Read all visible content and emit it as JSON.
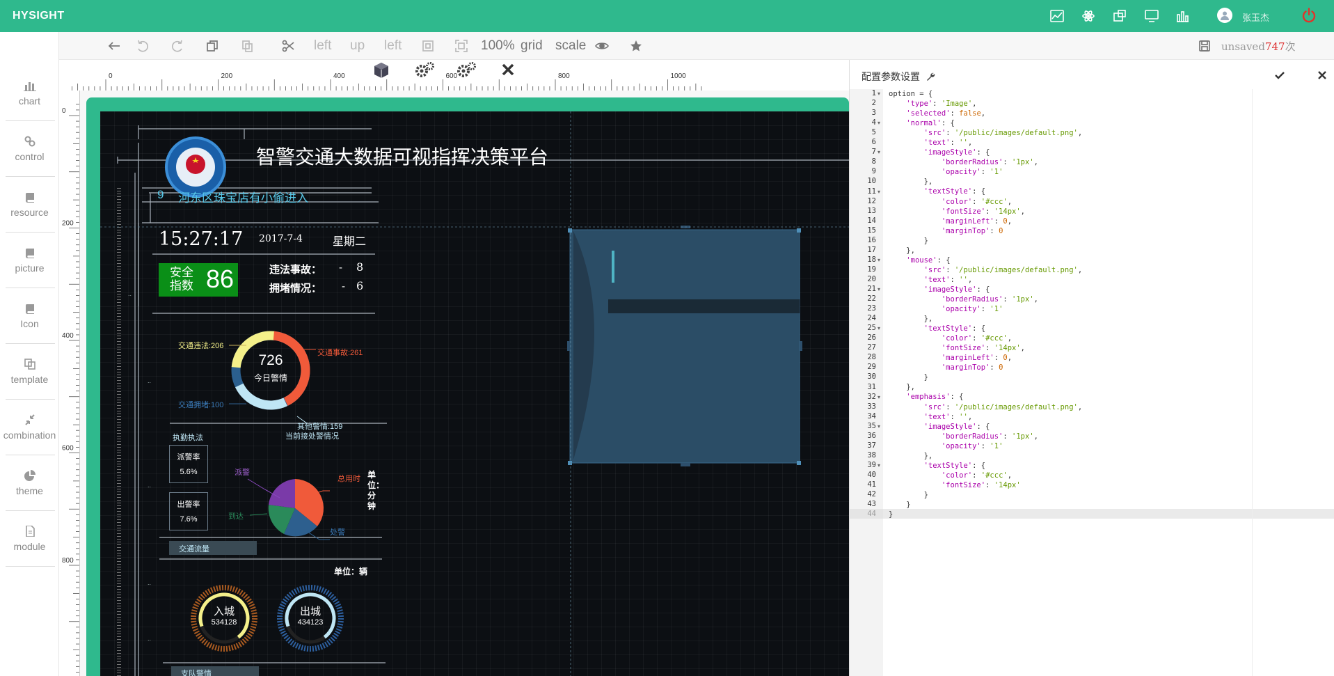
{
  "app": {
    "brand": "HYSIGHT",
    "username": "张玉杰"
  },
  "topbar_icons": [
    "image-chart-icon",
    "atom-icon",
    "puzzle-icon",
    "monitor-icon",
    "bar-chart-icon"
  ],
  "sidebar": {
    "items": [
      {
        "label": "chart",
        "icon": "chart-icon"
      },
      {
        "label": "control",
        "icon": "link-icon"
      },
      {
        "label": "resource",
        "icon": "book-icon"
      },
      {
        "label": "picture",
        "icon": "book-icon"
      },
      {
        "label": "Icon",
        "icon": "book-icon"
      },
      {
        "label": "template",
        "icon": "copy-icon"
      },
      {
        "label": "combination",
        "icon": "compress-icon"
      },
      {
        "label": "theme",
        "icon": "pie-icon"
      },
      {
        "label": "module",
        "icon": "file-icon"
      }
    ]
  },
  "toolbar": {
    "left1": "left",
    "up": "up",
    "left2": "left",
    "zoom": "100%",
    "grid": "grid",
    "scale": "scale",
    "save_prefix": "unsaved",
    "save_count": "747",
    "save_suffix": "次"
  },
  "rulers": {
    "h": [
      "0",
      "200",
      "400",
      "600",
      "800",
      "1000"
    ],
    "v": [
      "0",
      "200",
      "400",
      "600",
      "800"
    ]
  },
  "dashboard": {
    "title": "智警交通大数据可视指挥决策平台",
    "alert_num": "9",
    "alert_text": "河东区珠宝店有小偷进入",
    "time": "15:27:17",
    "date": "2017-7-4",
    "weekday": "星期二",
    "safety_label1": "安全",
    "safety_label2": "指数",
    "safety_value": "86",
    "violation_label": "违法事故：",
    "violation_dash": "-",
    "violation_value": "8",
    "jam_label": "拥堵情况：",
    "jam_dash": "-",
    "jam_value": "6",
    "donut_total": "726",
    "donut_caption": "今日警情",
    "donut_labels": {
      "a": "交通违法:206",
      "b": "交通事故:261",
      "c": "交通拥堵:100",
      "d": "其他警情:159"
    },
    "enforce_title": "执勤执法",
    "handling_title": "当前接处警情况",
    "dispatch_label": "派警率",
    "dispatch_value": "5.6%",
    "outgoing_label": "出警率",
    "outgoing_value": "7.6%",
    "pie_labels": {
      "a": "派警",
      "b": "总用时",
      "c": "到达",
      "d": "处警"
    },
    "unit_vertical": "单位：分钟",
    "flow_title": "交通流量",
    "unit_vehicle": "单位：辆",
    "in_label": "入城",
    "in_value": "534128",
    "out_label": "出城",
    "out_value": "434123",
    "bottom_title": "支队警情"
  },
  "panel": {
    "title": "配置参数设置"
  },
  "code_lines": [
    [
      [
        "p",
        "option = {"
      ]
    ],
    [
      [
        "p",
        "    "
      ],
      [
        "k",
        "'type'"
      ],
      [
        "p",
        ": "
      ],
      [
        "s",
        "'Image'"
      ],
      [
        "p",
        ","
      ]
    ],
    [
      [
        "p",
        "    "
      ],
      [
        "k",
        "'selected'"
      ],
      [
        "p",
        ": "
      ],
      [
        "b",
        "false"
      ],
      [
        "p",
        ","
      ]
    ],
    [
      [
        "p",
        "    "
      ],
      [
        "k",
        "'normal'"
      ],
      [
        "p",
        ": {"
      ]
    ],
    [
      [
        "p",
        "        "
      ],
      [
        "k",
        "'src'"
      ],
      [
        "p",
        ": "
      ],
      [
        "s",
        "'/public/images/default.png'"
      ],
      [
        "p",
        ","
      ]
    ],
    [
      [
        "p",
        "        "
      ],
      [
        "k",
        "'text'"
      ],
      [
        "p",
        ": "
      ],
      [
        "s",
        "''"
      ],
      [
        "p",
        ","
      ]
    ],
    [
      [
        "p",
        "        "
      ],
      [
        "k",
        "'imageStyle'"
      ],
      [
        "p",
        ": {"
      ]
    ],
    [
      [
        "p",
        "            "
      ],
      [
        "k",
        "'borderRadius'"
      ],
      [
        "p",
        ": "
      ],
      [
        "s",
        "'1px'"
      ],
      [
        "p",
        ","
      ]
    ],
    [
      [
        "p",
        "            "
      ],
      [
        "k",
        "'opacity'"
      ],
      [
        "p",
        ": "
      ],
      [
        "s",
        "'1'"
      ]
    ],
    [
      [
        "p",
        "        },"
      ]
    ],
    [
      [
        "p",
        "        "
      ],
      [
        "k",
        "'textStyle'"
      ],
      [
        "p",
        ": {"
      ]
    ],
    [
      [
        "p",
        "            "
      ],
      [
        "k",
        "'color'"
      ],
      [
        "p",
        ": "
      ],
      [
        "s",
        "'#ccc'"
      ],
      [
        "p",
        ","
      ]
    ],
    [
      [
        "p",
        "            "
      ],
      [
        "k",
        "'fontSize'"
      ],
      [
        "p",
        ": "
      ],
      [
        "s",
        "'14px'"
      ],
      [
        "p",
        ","
      ]
    ],
    [
      [
        "p",
        "            "
      ],
      [
        "k",
        "'marginLeft'"
      ],
      [
        "p",
        ": "
      ],
      [
        "b",
        "0"
      ],
      [
        "p",
        ","
      ]
    ],
    [
      [
        "p",
        "            "
      ],
      [
        "k",
        "'marginTop'"
      ],
      [
        "p",
        ": "
      ],
      [
        "b",
        "0"
      ]
    ],
    [
      [
        "p",
        "        }"
      ]
    ],
    [
      [
        "p",
        "    },"
      ]
    ],
    [
      [
        "p",
        "    "
      ],
      [
        "k",
        "'mouse'"
      ],
      [
        "p",
        ": {"
      ]
    ],
    [
      [
        "p",
        "        "
      ],
      [
        "k",
        "'src'"
      ],
      [
        "p",
        ": "
      ],
      [
        "s",
        "'/public/images/default.png'"
      ],
      [
        "p",
        ","
      ]
    ],
    [
      [
        "p",
        "        "
      ],
      [
        "k",
        "'text'"
      ],
      [
        "p",
        ": "
      ],
      [
        "s",
        "''"
      ],
      [
        "p",
        ","
      ]
    ],
    [
      [
        "p",
        "        "
      ],
      [
        "k",
        "'imageStyle'"
      ],
      [
        "p",
        ": {"
      ]
    ],
    [
      [
        "p",
        "            "
      ],
      [
        "k",
        "'borderRadius'"
      ],
      [
        "p",
        ": "
      ],
      [
        "s",
        "'1px'"
      ],
      [
        "p",
        ","
      ]
    ],
    [
      [
        "p",
        "            "
      ],
      [
        "k",
        "'opacity'"
      ],
      [
        "p",
        ": "
      ],
      [
        "s",
        "'1'"
      ]
    ],
    [
      [
        "p",
        "        },"
      ]
    ],
    [
      [
        "p",
        "        "
      ],
      [
        "k",
        "'textStyle'"
      ],
      [
        "p",
        ": {"
      ]
    ],
    [
      [
        "p",
        "            "
      ],
      [
        "k",
        "'color'"
      ],
      [
        "p",
        ": "
      ],
      [
        "s",
        "'#ccc'"
      ],
      [
        "p",
        ","
      ]
    ],
    [
      [
        "p",
        "            "
      ],
      [
        "k",
        "'fontSize'"
      ],
      [
        "p",
        ": "
      ],
      [
        "s",
        "'14px'"
      ],
      [
        "p",
        ","
      ]
    ],
    [
      [
        "p",
        "            "
      ],
      [
        "k",
        "'marginLeft'"
      ],
      [
        "p",
        ": "
      ],
      [
        "b",
        "0"
      ],
      [
        "p",
        ","
      ]
    ],
    [
      [
        "p",
        "            "
      ],
      [
        "k",
        "'marginTop'"
      ],
      [
        "p",
        ": "
      ],
      [
        "b",
        "0"
      ]
    ],
    [
      [
        "p",
        "        }"
      ]
    ],
    [
      [
        "p",
        "    },"
      ]
    ],
    [
      [
        "p",
        "    "
      ],
      [
        "k",
        "'emphasis'"
      ],
      [
        "p",
        ": {"
      ]
    ],
    [
      [
        "p",
        "        "
      ],
      [
        "k",
        "'src'"
      ],
      [
        "p",
        ": "
      ],
      [
        "s",
        "'/public/images/default.png'"
      ],
      [
        "p",
        ","
      ]
    ],
    [
      [
        "p",
        "        "
      ],
      [
        "k",
        "'text'"
      ],
      [
        "p",
        ": "
      ],
      [
        "s",
        "''"
      ],
      [
        "p",
        ","
      ]
    ],
    [
      [
        "p",
        "        "
      ],
      [
        "k",
        "'imageStyle'"
      ],
      [
        "p",
        ": {"
      ]
    ],
    [
      [
        "p",
        "            "
      ],
      [
        "k",
        "'borderRadius'"
      ],
      [
        "p",
        ": "
      ],
      [
        "s",
        "'1px'"
      ],
      [
        "p",
        ","
      ]
    ],
    [
      [
        "p",
        "            "
      ],
      [
        "k",
        "'opacity'"
      ],
      [
        "p",
        ": "
      ],
      [
        "s",
        "'1'"
      ]
    ],
    [
      [
        "p",
        "        },"
      ]
    ],
    [
      [
        "p",
        "        "
      ],
      [
        "k",
        "'textStyle'"
      ],
      [
        "p",
        ": {"
      ]
    ],
    [
      [
        "p",
        "            "
      ],
      [
        "k",
        "'color'"
      ],
      [
        "p",
        ": "
      ],
      [
        "s",
        "'#ccc'"
      ],
      [
        "p",
        ","
      ]
    ],
    [
      [
        "p",
        "            "
      ],
      [
        "k",
        "'fontSize'"
      ],
      [
        "p",
        ": "
      ],
      [
        "s",
        "'14px'"
      ]
    ],
    [
      [
        "p",
        "        }"
      ]
    ],
    [
      [
        "p",
        "    }"
      ]
    ],
    [
      [
        "p",
        "}"
      ]
    ]
  ],
  "colors": {
    "brand": "#2fb98d",
    "power": "#e0342a",
    "safety": "#0a8f17"
  }
}
